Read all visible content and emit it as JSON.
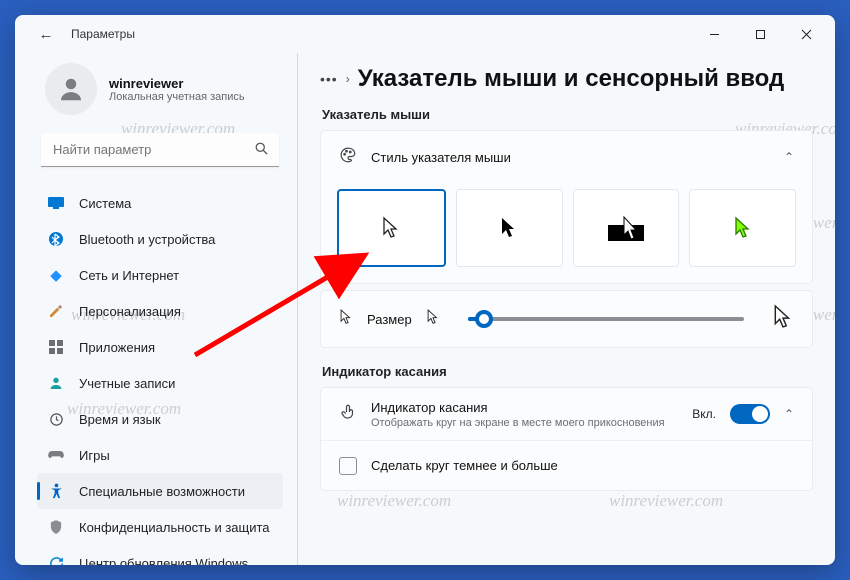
{
  "window": {
    "title": "Параметры"
  },
  "user": {
    "name": "winreviewer",
    "subtitle": "Локальная учетная запись"
  },
  "search": {
    "placeholder": "Найти параметр"
  },
  "nav": [
    {
      "label": "Система",
      "icon": "system"
    },
    {
      "label": "Bluetooth и устройства",
      "icon": "bluetooth"
    },
    {
      "label": "Сеть и Интернет",
      "icon": "network"
    },
    {
      "label": "Персонализация",
      "icon": "personalize"
    },
    {
      "label": "Приложения",
      "icon": "apps"
    },
    {
      "label": "Учетные записи",
      "icon": "accounts"
    },
    {
      "label": "Время и язык",
      "icon": "time"
    },
    {
      "label": "Игры",
      "icon": "gaming"
    },
    {
      "label": "Специальные возможности",
      "icon": "access",
      "active": true
    },
    {
      "label": "Конфиденциальность и защита",
      "icon": "privacy"
    },
    {
      "label": "Центр обновления Windows",
      "icon": "update"
    }
  ],
  "page": {
    "title": "Указатель мыши и сенсорный ввод",
    "section1": "Указатель мыши",
    "style_card": "Стиль указателя мыши",
    "size_label": "Размер",
    "section2": "Индикатор касания",
    "touch_card": {
      "title": "Индикатор касания",
      "subtitle": "Отображать круг на экране в месте моего прикосновения",
      "state": "Вкл."
    },
    "checkbox_label": "Сделать круг темнее и больше"
  },
  "watermark": "winreviewer.com"
}
